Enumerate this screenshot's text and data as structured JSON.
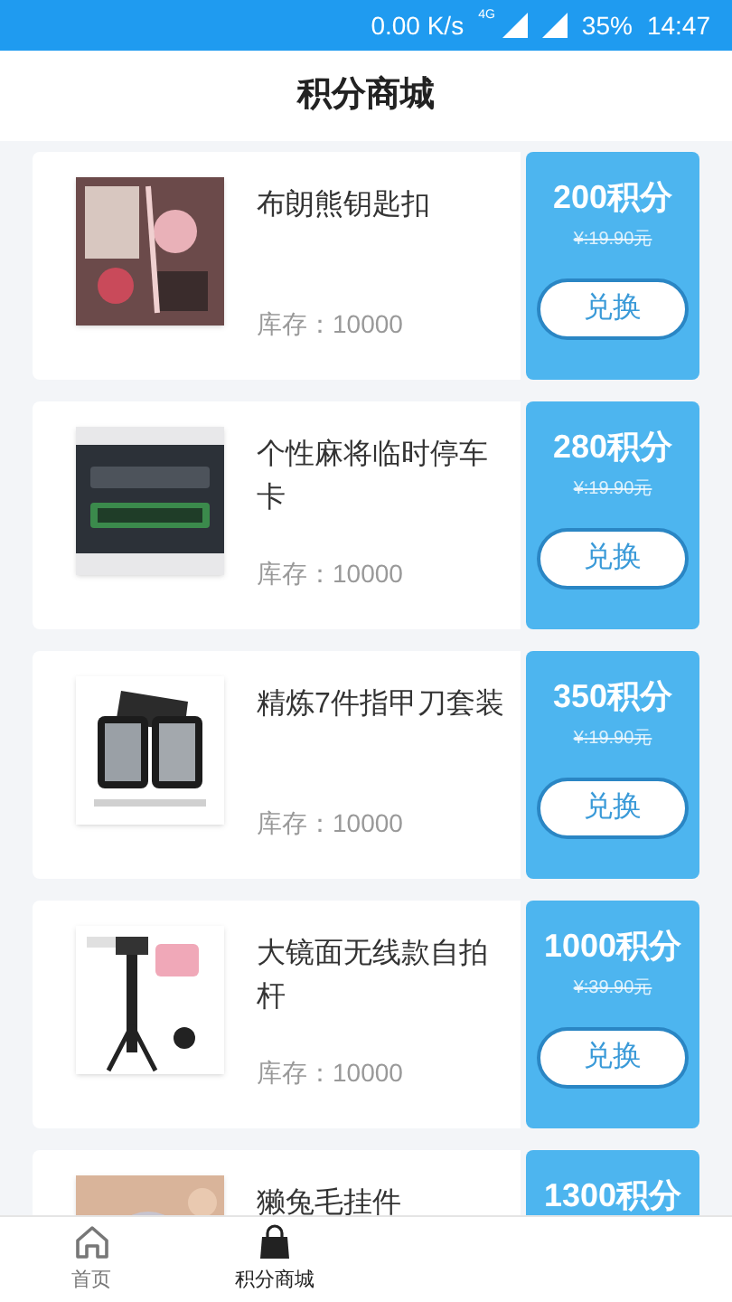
{
  "status_bar": {
    "speed": "0.00 K/s",
    "network": "4G",
    "battery": "35%",
    "time": "14:47"
  },
  "header": {
    "title": "积分商城"
  },
  "products": [
    {
      "name": "布朗熊钥匙扣",
      "stock": "库存：10000",
      "points": "200积分",
      "original_price": "¥:19.90元",
      "button": "兑换"
    },
    {
      "name": "个性麻将临时停车卡",
      "stock": "库存：10000",
      "points": "280积分",
      "original_price": "¥:19.90元",
      "button": "兑换"
    },
    {
      "name": "精炼7件指甲刀套装",
      "stock": "库存：10000",
      "points": "350积分",
      "original_price": "¥:19.90元",
      "button": "兑换"
    },
    {
      "name": "大镜面无线款自拍杆",
      "stock": "库存：10000",
      "points": "1000积分",
      "original_price": "¥:39.90元",
      "button": "兑换"
    },
    {
      "name": "獭兔毛挂件",
      "points": "1300积分"
    }
  ],
  "tab_bar": [
    {
      "label": "首页",
      "kind": "home",
      "selected": false
    },
    {
      "label": "积分商城",
      "kind": "bag",
      "selected": true
    }
  ]
}
